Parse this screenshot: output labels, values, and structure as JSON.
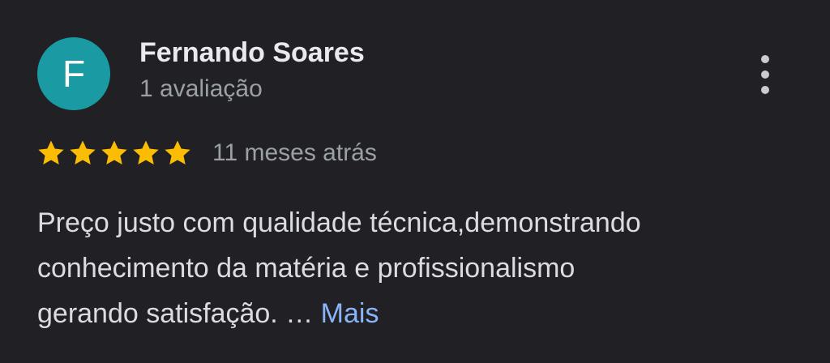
{
  "review": {
    "author_initial": "F",
    "author_name": "Fernando Soares",
    "review_count": "1 avaliação",
    "rating": 5,
    "rating_max": 5,
    "time_ago": "11 meses atrás",
    "text_lines": [
      "Preço justo com qualidade técnica,demonstrando",
      "conhecimento da matéria e profissionalismo",
      "gerando satisfação. …"
    ],
    "more_label": "Mais"
  },
  "icons": {
    "menu": "more-vert-icon",
    "star": "star-icon"
  },
  "colors": {
    "background": "#212125",
    "avatar": "#1a9aa3",
    "star": "#fbbc04",
    "link": "#8ab4f8"
  }
}
